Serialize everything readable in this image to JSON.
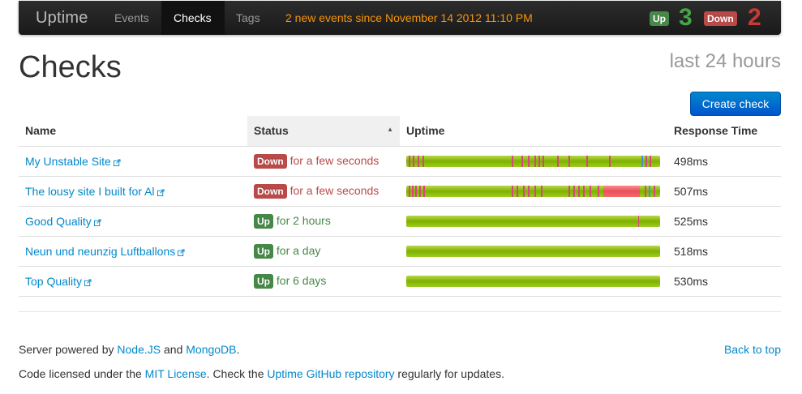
{
  "navbar": {
    "brand": "Uptime",
    "items": [
      {
        "label": "Events"
      },
      {
        "label": "Checks"
      },
      {
        "label": "Tags"
      }
    ],
    "notice": "2 new events since November 14 2012 11:10 PM",
    "up_label": "Up",
    "up_count": "3",
    "down_label": "Down",
    "down_count": "2"
  },
  "header": {
    "title": "Checks",
    "period": "last 24 hours",
    "create_button": "Create check"
  },
  "table": {
    "columns": [
      "Name",
      "Status",
      "Uptime",
      "Response Time"
    ],
    "rows": [
      {
        "name": "My Unstable Site",
        "status_label": "Down",
        "status_text": "for a few seconds",
        "response": "498ms"
      },
      {
        "name": "The lousy site I built for Al",
        "status_label": "Down",
        "status_text": "for a few seconds",
        "response": "507ms"
      },
      {
        "name": "Good Quality",
        "status_label": "Up",
        "status_text": "for 2 hours",
        "response": "525ms"
      },
      {
        "name": "Neun und neunzig Luftballons",
        "status_label": "Up",
        "status_text": "for a day",
        "response": "518ms"
      },
      {
        "name": "Top Quality",
        "status_label": "Up",
        "status_text": "for 6 days",
        "response": "530ms"
      }
    ]
  },
  "footer": {
    "line1_prefix": "Server powered by ",
    "nodejs": "Node.JS",
    "and": " and ",
    "mongodb": "MongoDB",
    "line1_suffix": ".",
    "line2_prefix": "Code licensed under the ",
    "mit": "MIT License",
    "line2_mid": ". Check the ",
    "repo": "Uptime GitHub repository",
    "line2_suffix": " regularly for updates.",
    "back_to_top": "Back to top"
  },
  "colors": {
    "up": "#468847",
    "down": "#b94a48",
    "link": "#0088cc",
    "notice": "#f89406"
  }
}
